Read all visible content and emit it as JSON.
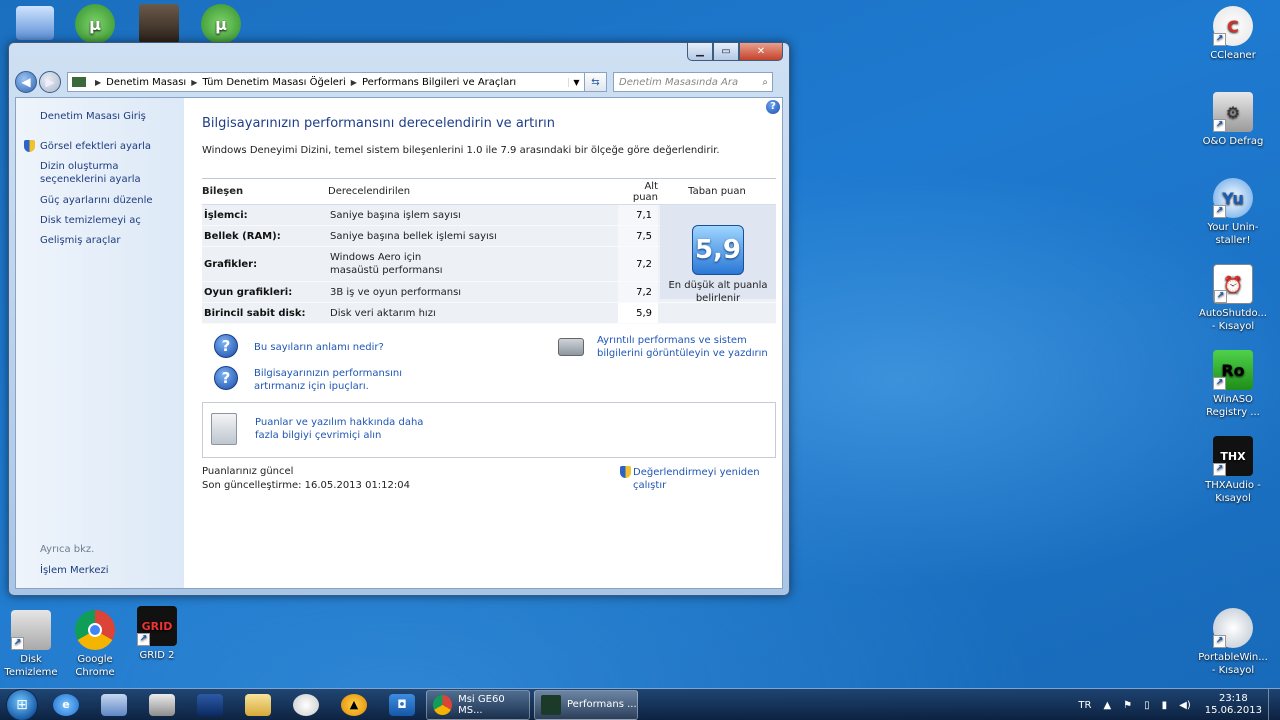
{
  "desktop": {
    "top_left_icons": [
      "",
      "",
      "",
      ""
    ],
    "right_icons": [
      {
        "label": "CCleaner",
        "icon": "ccleaner-icon"
      },
      {
        "label": "O&O Defrag",
        "icon": "defrag-icon"
      },
      {
        "label": "Your Unin-staller!",
        "icon": "uninstaller-icon"
      },
      {
        "label": "AutoShutdo... - Kısayol",
        "icon": "autoshutdown-icon"
      },
      {
        "label": "WinASO Registry ...",
        "icon": "winaso-icon"
      },
      {
        "label": "THXAudio - Kısayol",
        "icon": "thxaudio-icon"
      },
      {
        "label": "PortableWin... - Kısayol",
        "icon": "portablewin-icon"
      }
    ],
    "bottom_left_icons": [
      {
        "label": "Disk Temizleme",
        "icon": "disk-cleanup-icon"
      },
      {
        "label": "Google Chrome",
        "icon": "chrome-icon"
      },
      {
        "label": "GRID 2",
        "icon": "grid2-icon"
      }
    ]
  },
  "window": {
    "caption_buttons": {
      "minimize": "▁",
      "maximize": "▭",
      "close": "✕"
    },
    "breadcrumb": [
      "Denetim Masası",
      "Tüm Denetim Masası Öğeleri",
      "Performans Bilgileri ve Araçları"
    ],
    "search_placeholder": "Denetim Masasında Ara",
    "left_pane": {
      "home": "Denetim Masası Giriş",
      "links": [
        "Görsel efektleri ayarla",
        "Dizin oluşturma seçeneklerini ayarla",
        "Güç ayarlarını düzenle",
        "Disk temizlemeyi aç",
        "Gelişmiş araçlar"
      ],
      "see_also_label": "Ayrıca bkz.",
      "see_also_link": "İşlem Merkezi"
    },
    "main": {
      "title": "Bilgisayarınızın performansını derecelendirin ve artırın",
      "subtitle": "Windows Deneyimi Dizini, temel sistem bileşenlerini 1.0 ile 7.9 arasındaki bir ölçeğe göre değerlendirir.",
      "table": {
        "headers": [
          "Bileşen",
          "Derecelendirilen",
          "Alt puan",
          "Taban puan"
        ],
        "rows": [
          {
            "component": "İşlemci:",
            "rated": "Saniye başına işlem sayısı",
            "subscore": "7,1"
          },
          {
            "component": "Bellek (RAM):",
            "rated": "Saniye başına bellek işlemi sayısı",
            "subscore": "7,5"
          },
          {
            "component": "Grafikler:",
            "rated": "Windows Aero için masaüstü performansı",
            "subscore": "7,2"
          },
          {
            "component": "Oyun grafikleri:",
            "rated": "3B iş ve oyun performansı",
            "subscore": "7,2"
          },
          {
            "component": "Birincil sabit disk:",
            "rated": "Disk veri aktarım hızı",
            "subscore": "5,9"
          }
        ],
        "base_score": "5,9",
        "base_caption": "En düşük alt puanla belirlenir"
      },
      "links": {
        "meaning": "Bu sayıların anlamı nedir?",
        "tips": "Bilgisayarınızın performansını artırmanız için ipuçları.",
        "details": "Ayrıntılı performans ve sistem bilgilerini görüntüleyin ve yazdırın",
        "online": "Puanlar ve yazılım hakkında daha fazla bilgiyi çevrimiçi alın"
      },
      "status": {
        "current": "Puanlarınız güncel",
        "last_update": "Son güncelleştirme: 16.05.2013 01:12:04",
        "rerun": "Değerlendirmeyi yeniden çalıştır"
      }
    }
  },
  "taskbar": {
    "tasks": [
      {
        "label": "Msi GE60 MS...",
        "icon": "chrome-icon"
      },
      {
        "label": "Performans ...",
        "icon": "performance-icon"
      }
    ],
    "lang": "TR",
    "time": "23:18",
    "date": "15.06.2013"
  }
}
